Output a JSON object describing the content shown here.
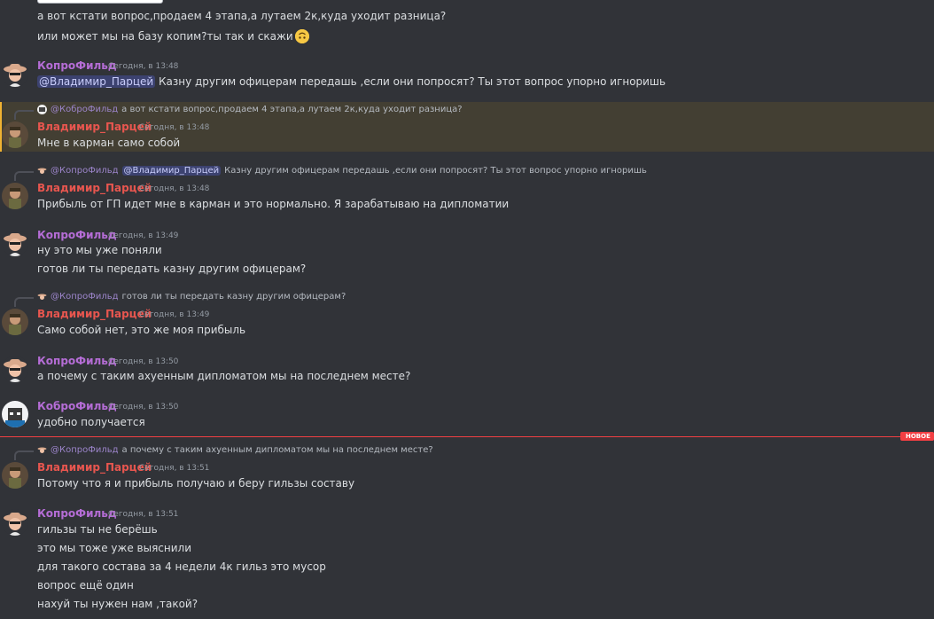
{
  "messages": {
    "m0": {
      "line1": "а вот кстати вопрос,продаем 4 этапа,а лутаем 2к,куда уходит разница?",
      "line2": "или может мы на базу копим?ты так и скажи",
      "emoji": "upside-down-face"
    },
    "m1": {
      "author": "КопроФильд",
      "time": "Сегодня, в 13:48",
      "mention": "@Владимир_Парцей",
      "text": " Казну другим офицерам передашь ,если они попросят? Ты этот вопрос упорно игноришь"
    },
    "m2": {
      "reply_author": "@КоброФильд",
      "reply_text": "а вот кстати вопрос,продаем 4 этапа,а лутаем 2к,куда уходит разница?",
      "author": "Владимир_Парцей",
      "time": "Сегодня, в 13:48",
      "text": "Мне в карман само собой"
    },
    "m3": {
      "reply_author": "@КопроФильд",
      "reply_mention": "@Владимир_Парцей",
      "reply_text": "Казну другим офицерам передашь ,если они попросят? Ты этот вопрос упорно игноришь",
      "author": "Владимир_Парцей",
      "time": "Сегодня, в 13:48",
      "text": "Прибыль от ГП идет мне в карман и это нормально. Я зарабатываю на дипломатии"
    },
    "m4": {
      "author": "КопроФильд",
      "time": "Сегодня, в 13:49",
      "line1": "ну это мы уже поняли",
      "line2": "готов ли ты передать казну другим офицерам?"
    },
    "m5": {
      "reply_author": "@КопроФильд",
      "reply_text": "готов ли ты передать казну другим офицерам?",
      "author": "Владимир_Парцей",
      "time": "Сегодня, в 13:49",
      "text": "Само собой нет, это же моя прибыль"
    },
    "m6": {
      "author": "КопроФильд",
      "time": "Сегодня, в 13:50",
      "text": "а почему с таким ахуенным дипломатом мы на последнем месте?"
    },
    "m7": {
      "author": "КоброФильд",
      "time": "Сегодня, в 13:50",
      "text": "удобно получается"
    },
    "divider": {
      "label": "НОВОЕ"
    },
    "m8": {
      "reply_author": "@КопроФильд",
      "reply_text": "а почему с таким ахуенным дипломатом мы на последнем месте?",
      "author": "Владимир_Парцей",
      "time": "Сегодня, в 13:51",
      "text": "Потому что я и прибыль получаю и беру гильзы составу"
    },
    "m9": {
      "author": "КопроФильд",
      "time": "Сегодня, в 13:51",
      "lines": [
        "гильзы ты не берёшь",
        "это мы тоже уже выяснили",
        "для такого состава за 4 недели 4к гильз это мусор",
        "вопрос ещё один",
        "нахуй ты нужен нам ,такой?"
      ]
    }
  },
  "colors": {
    "background": "#313338",
    "highlight": "#433f33",
    "purple_name": "#b56dd6",
    "red_name": "#e8564f",
    "new_divider": "#f23f43"
  }
}
